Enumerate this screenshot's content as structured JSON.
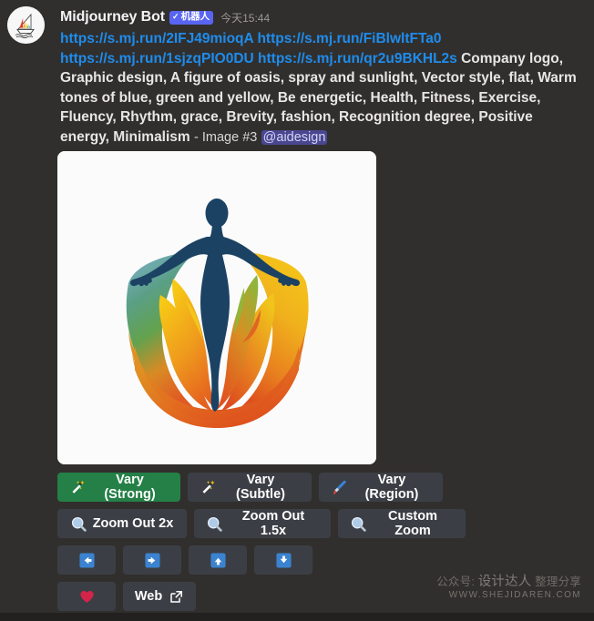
{
  "message": {
    "author": "Midjourney Bot",
    "bot_badge": {
      "check": "✓",
      "label": "机器人"
    },
    "timestamp": "今天15:44",
    "avatar_icon": "sailboat-rainbow-avatar",
    "links": [
      "https://s.mj.run/2IFJ49mioqA",
      "https://s.mj.run/FiBlwltFTa0",
      "https://s.mj.run/1sjzqPIO0DU",
      "https://s.mj.run/qr2u9BKHL2s"
    ],
    "prompt": "Company logo, Graphic design, A figure of oasis, spray and sunlight, Vector style, flat, Warm tones of blue, green and yellow, Be energetic, Health, Fitness, Exercise, Fluency, Rhythm, grace, Brevity, fashion, Recognition degree, Positive energy, Minimalism",
    "image_label": "- Image #3",
    "mention": "@aidesign"
  },
  "attachment": {
    "alt": "Fitness oasis logo: navy human figure with arms outstretched inside gradient circle of blue, green, yellow and orange flame petals",
    "background": "#fbfbfb",
    "figure_color": "#1b4263",
    "gradient_stops": {
      "left_top": "#6aa3c4",
      "left_mid": "#4e9a62",
      "left_bottom": "#e2672a",
      "right_top": "#f2c218",
      "right_bottom": "#e2551f",
      "inner_green": "#8cb33c",
      "inner_yellow": "#f6c61b",
      "inner_orange": "#e35a20"
    }
  },
  "buttons": {
    "rows": [
      [
        {
          "label": "Vary (Strong)",
          "icon": "magic-wand-icon",
          "style": "primary",
          "width": "w-135"
        },
        {
          "label": "Vary (Subtle)",
          "icon": "magic-wand-icon",
          "style": "default",
          "width": "w-136"
        },
        {
          "label": "Vary (Region)",
          "icon": "paintbrush-icon",
          "style": "default",
          "width": "w-136"
        }
      ],
      [
        {
          "label": "Zoom Out 2x",
          "icon": "magnifier-icon",
          "style": "default",
          "width": "w-142"
        },
        {
          "label": "Zoom Out 1.5x",
          "icon": "magnifier-icon",
          "style": "default",
          "width": "w-150"
        },
        {
          "label": "Custom Zoom",
          "icon": "magnifier-icon",
          "style": "default",
          "width": "w-140"
        }
      ],
      [
        {
          "label": "",
          "icon": "arrow-left-icon",
          "style": "default",
          "width": "w-64"
        },
        {
          "label": "",
          "icon": "arrow-right-icon",
          "style": "default",
          "width": "w-64"
        },
        {
          "label": "",
          "icon": "arrow-up-icon",
          "style": "default",
          "width": "w-64"
        },
        {
          "label": "",
          "icon": "arrow-down-icon",
          "style": "default",
          "width": "w-64"
        }
      ],
      [
        {
          "label": "",
          "icon": "heart-icon",
          "style": "default",
          "width": "w-64"
        },
        {
          "label": "Web",
          "icon": "external-link-icon",
          "style": "default",
          "width": "w-80",
          "icon_after": true
        }
      ]
    ],
    "accent_green": "#248046",
    "surface": "#3b3f45"
  },
  "watermark": {
    "line1_prefix": "公众号:",
    "line1_brand": "设计达人",
    "line1_suffix": "整理分享",
    "line2": "WWW.SHEJIDAREN.COM"
  }
}
